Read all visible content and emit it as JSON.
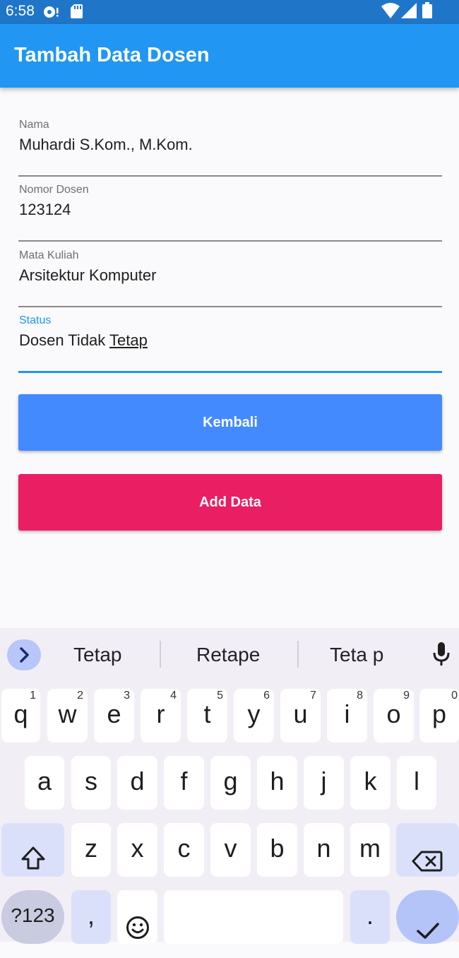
{
  "status_bar": {
    "time": "6:58"
  },
  "app_bar": {
    "title": "Tambah Data Dosen"
  },
  "form": {
    "nama": {
      "label": "Nama",
      "value": "Muhardi S.Kom., M.Kom."
    },
    "nomor": {
      "label": "Nomor Dosen",
      "value": "123124"
    },
    "matkul": {
      "label": "Mata Kuliah",
      "value": "Arsitektur Komputer"
    },
    "status": {
      "label": "Status",
      "value_prefix": "Dosen Tidak ",
      "value_composing": "Tetap"
    }
  },
  "buttons": {
    "kembali": "Kembali",
    "add_data": "Add Data"
  },
  "colors": {
    "app_bar": "#2196f3",
    "kembali": "#448aff",
    "add_data": "#e91e63",
    "status_bar": "#1f76c8"
  },
  "keyboard": {
    "suggestions": [
      "Tetap",
      "Retape",
      "Teta p"
    ],
    "row1": [
      {
        "k": "q",
        "n": "1"
      },
      {
        "k": "w",
        "n": "2"
      },
      {
        "k": "e",
        "n": "3"
      },
      {
        "k": "r",
        "n": "4"
      },
      {
        "k": "t",
        "n": "5"
      },
      {
        "k": "y",
        "n": "6"
      },
      {
        "k": "u",
        "n": "7"
      },
      {
        "k": "i",
        "n": "8"
      },
      {
        "k": "o",
        "n": "9"
      },
      {
        "k": "p",
        "n": "0"
      }
    ],
    "row2": [
      "a",
      "s",
      "d",
      "f",
      "g",
      "h",
      "j",
      "k",
      "l"
    ],
    "row3": [
      "z",
      "x",
      "c",
      "v",
      "b",
      "n",
      "m"
    ],
    "symbols_label": "?123",
    "comma": ",",
    "period": "."
  },
  "icons": [
    "chevron-right-icon",
    "microphone-icon",
    "shift-icon",
    "backspace-icon",
    "emoji-icon",
    "checkmark-icon",
    "wifi-icon",
    "signal-icon",
    "battery-icon",
    "sd-card-icon",
    "notification-icon"
  ]
}
